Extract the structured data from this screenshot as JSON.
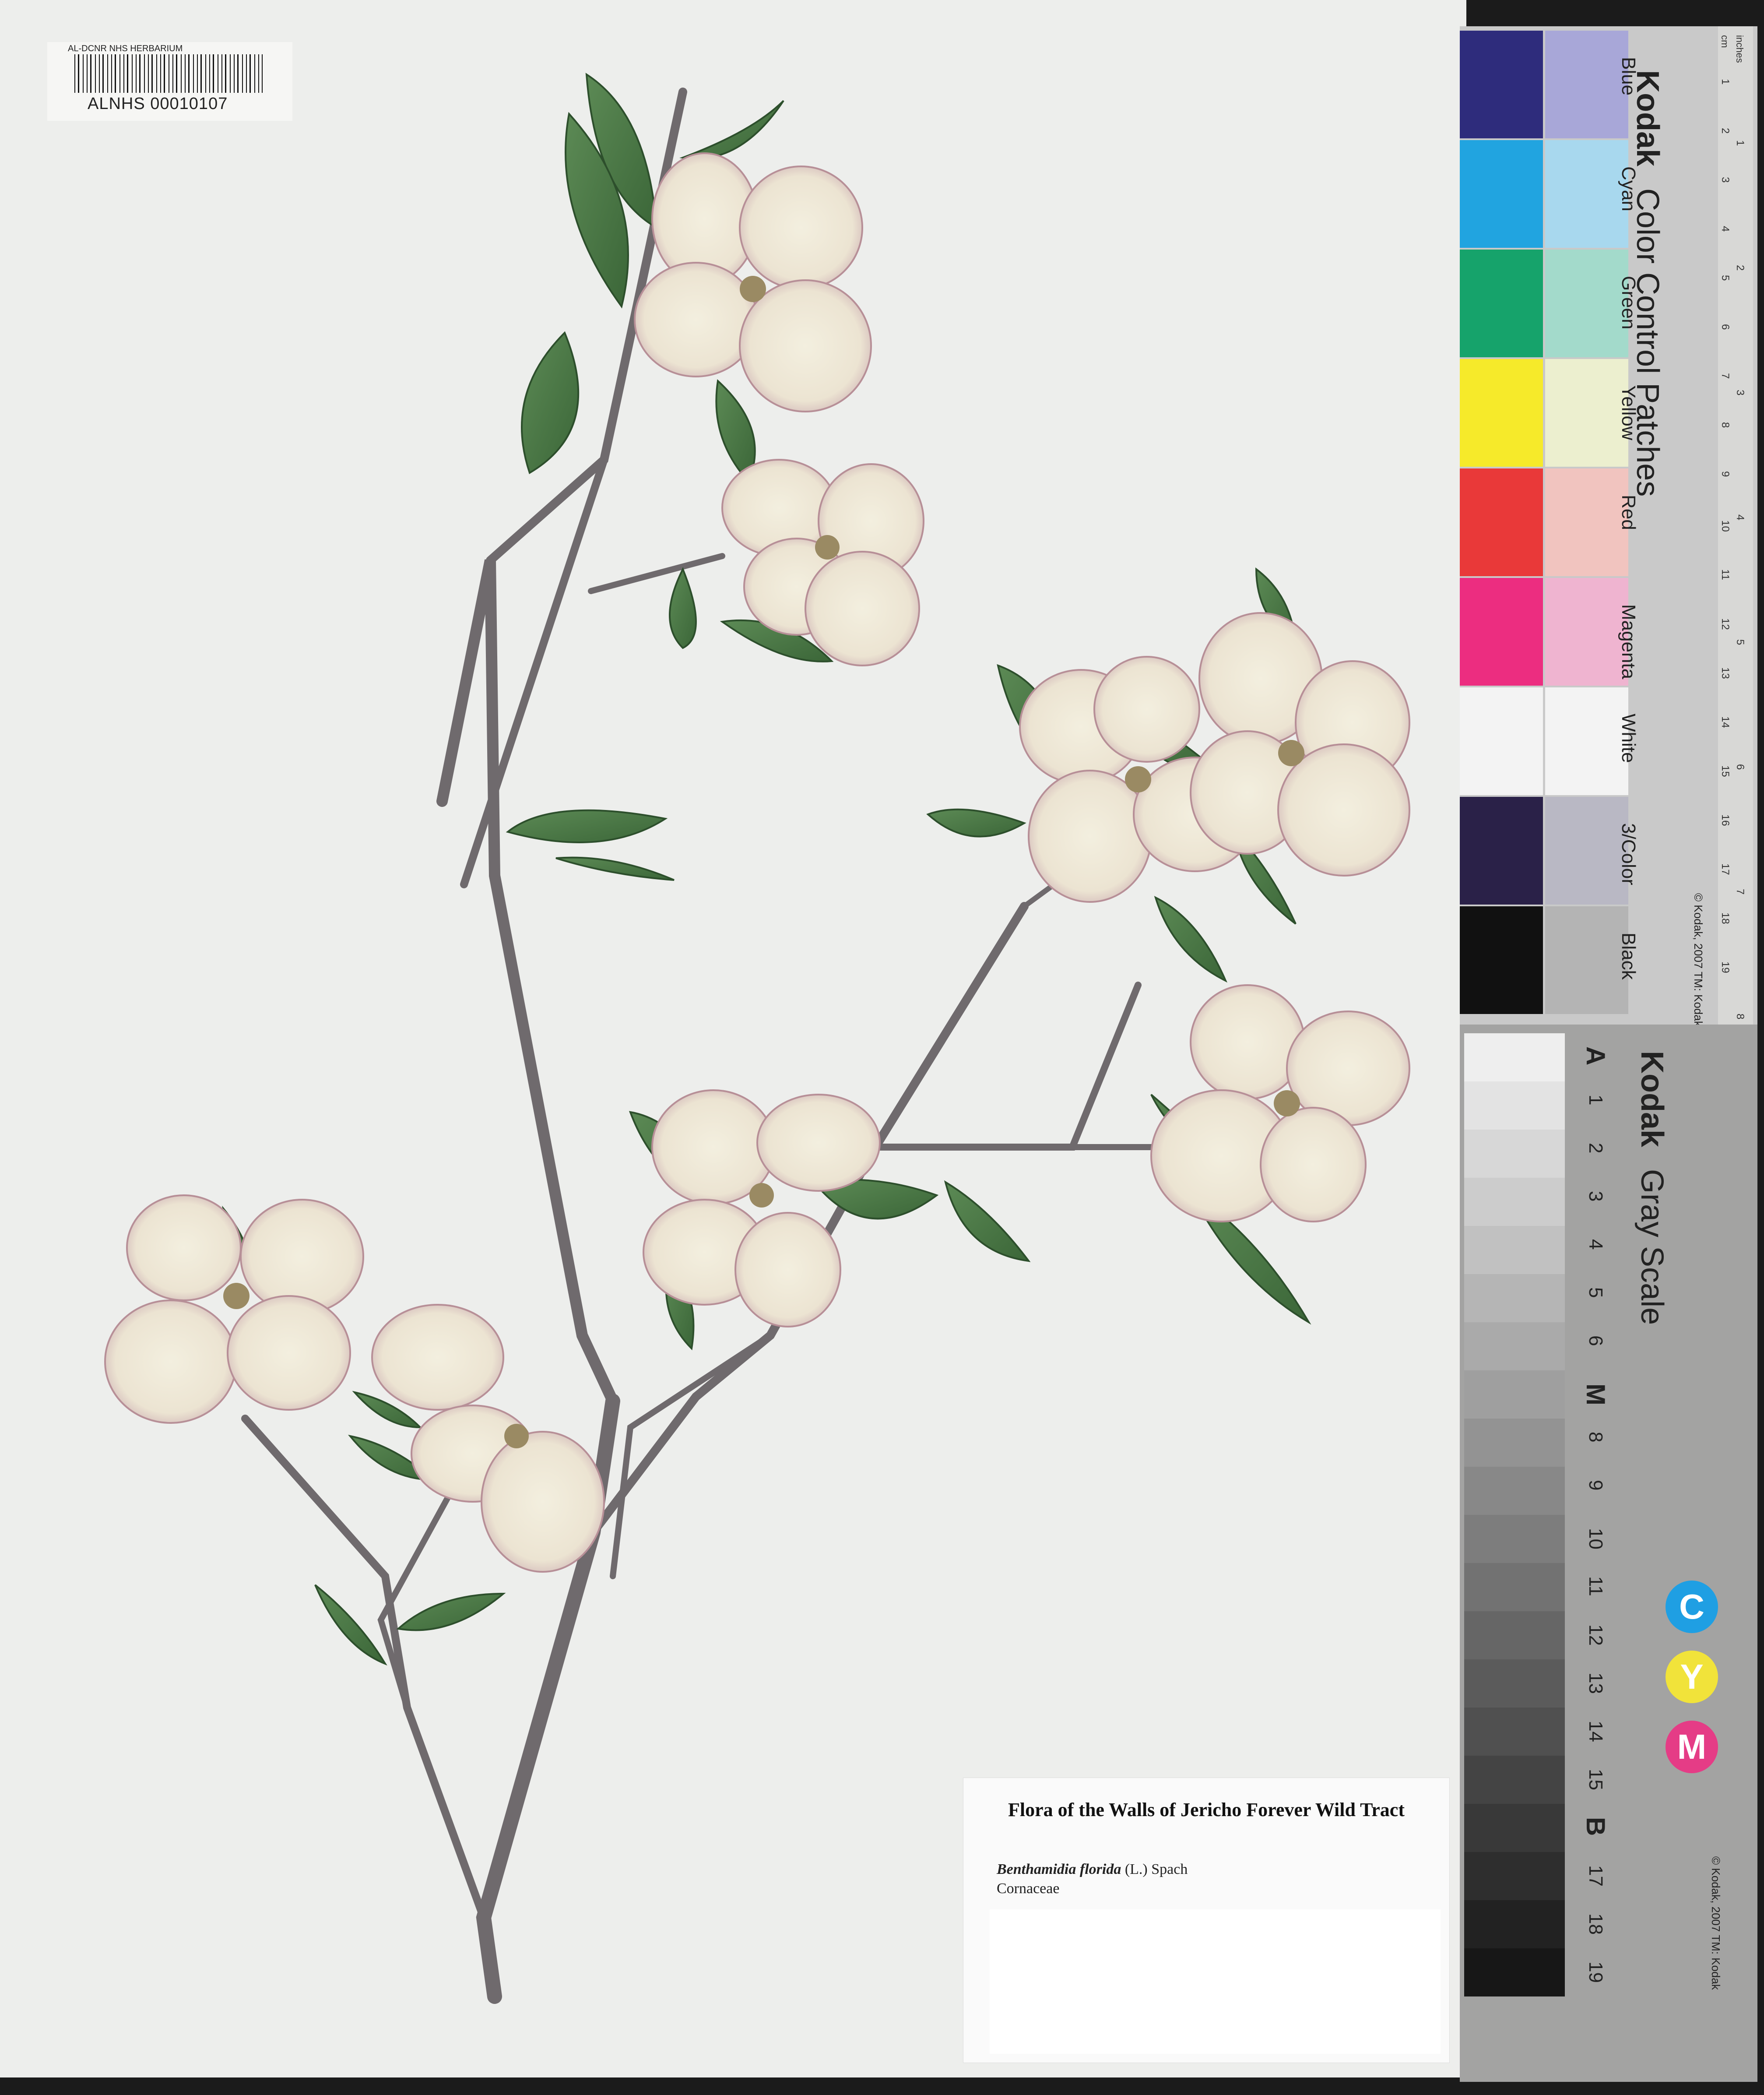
{
  "herbarium": {
    "barcode_header": "AL-DCNR NHS HERBARIUM",
    "accession": "ALNHS 00010107"
  },
  "label": {
    "title": "Flora of the Walls of Jericho Forever Wild Tract",
    "scientific_name": "Benthamidia florida",
    "authority": "(L.) Spach",
    "family": "Cornaceae"
  },
  "color_card": {
    "brand": "Kodak",
    "title": "Color Control Patches",
    "copyright": "© Kodak, 2007 TM: Kodak",
    "patches": [
      {
        "name": "Blue",
        "dark": "#2e2c7c",
        "light": "#a8a7d8"
      },
      {
        "name": "Cyan",
        "dark": "#21a4e0",
        "light": "#a8d8ee"
      },
      {
        "name": "Green",
        "dark": "#16a36b",
        "light": "#a3dacb"
      },
      {
        "name": "Yellow",
        "dark": "#f6ea2a",
        "light": "#ecefcf"
      },
      {
        "name": "Red",
        "dark": "#e93939",
        "light": "#f1c4bf"
      },
      {
        "name": "Magenta",
        "dark": "#ec2d80",
        "light": "#efb4d0"
      },
      {
        "name": "White",
        "dark": "#f3f3f3",
        "light": "#f3f3f3"
      },
      {
        "name": "3/Color",
        "dark": "#2a2148",
        "light": "#b9b8c4"
      },
      {
        "name": "Black",
        "dark": "#111111",
        "light": "#b4b4b4"
      }
    ],
    "ruler_units": [
      "cm",
      "inches"
    ],
    "cm_ticks": [
      "1",
      "2",
      "3",
      "4",
      "5",
      "6",
      "7",
      "8",
      "9",
      "10",
      "11",
      "12",
      "13",
      "14",
      "15",
      "16",
      "17",
      "18",
      "19"
    ],
    "inch_ticks": [
      "1",
      "2",
      "3",
      "4",
      "5",
      "6",
      "7",
      "8"
    ]
  },
  "gray_card": {
    "brand": "Kodak",
    "title": "Gray Scale",
    "copyright": "© Kodak, 2007 TM: Kodak",
    "steps": [
      "A",
      "1",
      "2",
      "3",
      "4",
      "5",
      "6",
      "M",
      "8",
      "9",
      "10",
      "11",
      "12",
      "13",
      "14",
      "15",
      "B",
      "17",
      "18",
      "19"
    ],
    "circles": [
      "C",
      "Y",
      "M"
    ],
    "circle_colors": [
      "#1f9fe3",
      "#f1e33a",
      "#e53c86"
    ]
  }
}
